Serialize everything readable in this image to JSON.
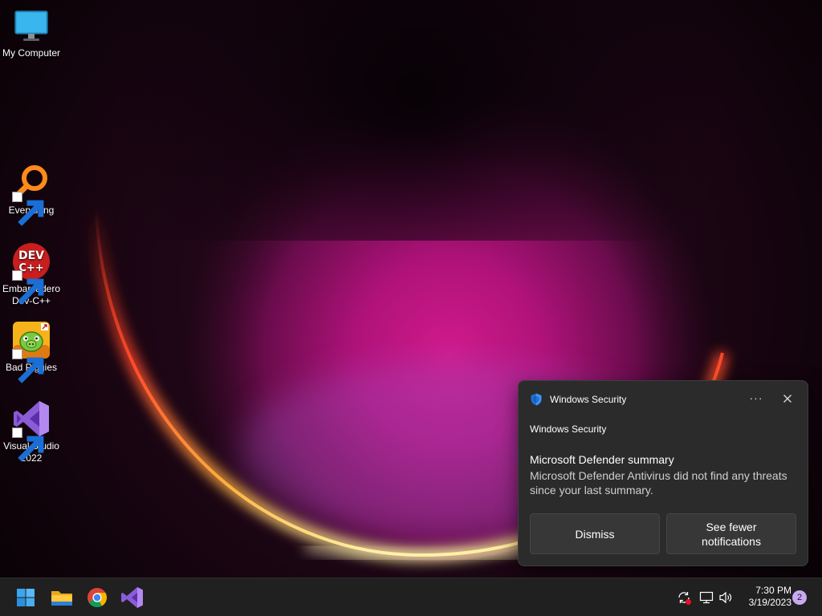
{
  "desktop": {
    "icons": [
      {
        "label": "My Computer",
        "icon": "monitor-icon"
      },
      {
        "label": "Everything",
        "icon": "magnifier-icon",
        "shortcut": true
      },
      {
        "label": "Embarcadero Dev-C++",
        "icon": "devcpp-icon",
        "icon_text_1": "DEV",
        "icon_text_2": "C++",
        "shortcut": true
      },
      {
        "label": "Bad Piggies",
        "icon": "pig-icon",
        "shortcut": true
      },
      {
        "label": "Visual Studio 2022",
        "icon": "visual-studio-icon",
        "shortcut": true
      }
    ]
  },
  "toast": {
    "app_name": "Windows Security",
    "app_icon": "shield-icon",
    "more_label": "···",
    "close_icon": "close-icon",
    "subtitle": "Windows Security",
    "title": "Microsoft Defender summary",
    "body": "Microsoft Defender Antivirus did not find any threats since your last summary.",
    "buttons": {
      "dismiss": "Dismiss",
      "fewer": "See fewer notifications"
    }
  },
  "taskbar": {
    "apps": [
      {
        "name": "Start",
        "icon": "windows-start-icon"
      },
      {
        "name": "File Explorer",
        "icon": "folder-icon"
      },
      {
        "name": "Google Chrome",
        "icon": "chrome-icon"
      },
      {
        "name": "Visual Studio",
        "icon": "visual-studio-icon"
      }
    ],
    "tray": [
      "sync-error-icon",
      "network-icon",
      "volume-icon"
    ],
    "clock": {
      "time": "7:30 PM",
      "date": "3/19/2023"
    },
    "notification_count": "2"
  },
  "colors": {
    "accent_blue": "#0078d4",
    "toast_bg": "#2b2b2b",
    "taskbar_bg": "#202020",
    "badge": "#c8a9f2"
  }
}
